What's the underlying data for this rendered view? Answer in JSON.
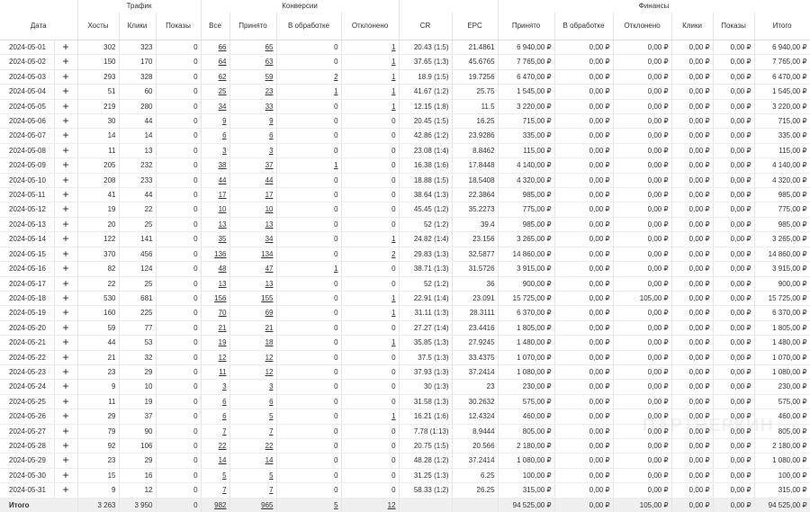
{
  "groups": {
    "traffic": "Трафик",
    "conversions": "Конверсии",
    "finance": "Финансы"
  },
  "columns": [
    "Дата",
    "Хосты",
    "Клики",
    "Показы",
    "Все",
    "Принято",
    "В обработке",
    "Отклонено",
    "CR",
    "EPC",
    "Принято",
    "В обработке",
    "Отклонено",
    "Клики",
    "Показы",
    "Итого"
  ],
  "rows": [
    [
      "2024-05-01",
      "302",
      "323",
      "0",
      "66",
      "65",
      "0",
      "1",
      "20.43 (1:5)",
      "21.4861",
      "6 940,00 ₽",
      "0,00 ₽",
      "0,00 ₽",
      "0,00 ₽",
      "0,00 ₽",
      "6 940,00 ₽"
    ],
    [
      "2024-05-02",
      "150",
      "170",
      "0",
      "64",
      "63",
      "0",
      "1",
      "37.65 (1:3)",
      "45.6765",
      "7 765,00 ₽",
      "0,00 ₽",
      "0,00 ₽",
      "0,00 ₽",
      "0,00 ₽",
      "7 765,00 ₽"
    ],
    [
      "2024-05-03",
      "293",
      "328",
      "0",
      "62",
      "59",
      "2",
      "1",
      "18.9 (1:5)",
      "19.7256",
      "6 470,00 ₽",
      "0,00 ₽",
      "0,00 ₽",
      "0,00 ₽",
      "0,00 ₽",
      "6 470,00 ₽"
    ],
    [
      "2024-05-04",
      "51",
      "60",
      "0",
      "25",
      "23",
      "1",
      "1",
      "41.67 (1:2)",
      "25.75",
      "1 545,00 ₽",
      "0,00 ₽",
      "0,00 ₽",
      "0,00 ₽",
      "0,00 ₽",
      "1 545,00 ₽"
    ],
    [
      "2024-05-05",
      "219",
      "280",
      "0",
      "34",
      "33",
      "0",
      "1",
      "12.15 (1:8)",
      "11.5",
      "3 220,00 ₽",
      "0,00 ₽",
      "0,00 ₽",
      "0,00 ₽",
      "0,00 ₽",
      "3 220,00 ₽"
    ],
    [
      "2024-05-06",
      "30",
      "44",
      "0",
      "9",
      "9",
      "0",
      "0",
      "20.45 (1:5)",
      "16.25",
      "715,00 ₽",
      "0,00 ₽",
      "0,00 ₽",
      "0,00 ₽",
      "0,00 ₽",
      "715,00 ₽"
    ],
    [
      "2024-05-07",
      "14",
      "14",
      "0",
      "6",
      "6",
      "0",
      "0",
      "42.86 (1:2)",
      "23.9286",
      "335,00 ₽",
      "0,00 ₽",
      "0,00 ₽",
      "0,00 ₽",
      "0,00 ₽",
      "335,00 ₽"
    ],
    [
      "2024-05-08",
      "11",
      "13",
      "0",
      "3",
      "3",
      "0",
      "0",
      "23.08 (1:4)",
      "8.8462",
      "115,00 ₽",
      "0,00 ₽",
      "0,00 ₽",
      "0,00 ₽",
      "0,00 ₽",
      "115,00 ₽"
    ],
    [
      "2024-05-09",
      "205",
      "232",
      "0",
      "38",
      "37",
      "1",
      "0",
      "16.38 (1:6)",
      "17.8448",
      "4 140,00 ₽",
      "0,00 ₽",
      "0,00 ₽",
      "0,00 ₽",
      "0,00 ₽",
      "4 140,00 ₽"
    ],
    [
      "2024-05-10",
      "208",
      "233",
      "0",
      "44",
      "44",
      "0",
      "0",
      "18.88 (1:5)",
      "18.5408",
      "4 320,00 ₽",
      "0,00 ₽",
      "0,00 ₽",
      "0,00 ₽",
      "0,00 ₽",
      "4 320,00 ₽"
    ],
    [
      "2024-05-11",
      "41",
      "44",
      "0",
      "17",
      "17",
      "0",
      "0",
      "38.64 (1:3)",
      "22.3864",
      "985,00 ₽",
      "0,00 ₽",
      "0,00 ₽",
      "0,00 ₽",
      "0,00 ₽",
      "985,00 ₽"
    ],
    [
      "2024-05-12",
      "19",
      "22",
      "0",
      "10",
      "10",
      "0",
      "0",
      "45.45 (1:2)",
      "35.2273",
      "775,00 ₽",
      "0,00 ₽",
      "0,00 ₽",
      "0,00 ₽",
      "0,00 ₽",
      "775,00 ₽"
    ],
    [
      "2024-05-13",
      "20",
      "25",
      "0",
      "13",
      "13",
      "0",
      "0",
      "52 (1:2)",
      "39.4",
      "985,00 ₽",
      "0,00 ₽",
      "0,00 ₽",
      "0,00 ₽",
      "0,00 ₽",
      "985,00 ₽"
    ],
    [
      "2024-05-14",
      "122",
      "141",
      "0",
      "35",
      "34",
      "0",
      "1",
      "24.82 (1:4)",
      "23.156",
      "3 265,00 ₽",
      "0,00 ₽",
      "0,00 ₽",
      "0,00 ₽",
      "0,00 ₽",
      "3 265,00 ₽"
    ],
    [
      "2024-05-15",
      "370",
      "456",
      "0",
      "136",
      "134",
      "0",
      "2",
      "29.83 (1:3)",
      "32.5877",
      "14 860,00 ₽",
      "0,00 ₽",
      "0,00 ₽",
      "0,00 ₽",
      "0,00 ₽",
      "14 860,00 ₽"
    ],
    [
      "2024-05-16",
      "82",
      "124",
      "0",
      "48",
      "47",
      "1",
      "0",
      "38.71 (1:3)",
      "31.5726",
      "3 915,00 ₽",
      "0,00 ₽",
      "0,00 ₽",
      "0,00 ₽",
      "0,00 ₽",
      "3 915,00 ₽"
    ],
    [
      "2024-05-17",
      "22",
      "25",
      "0",
      "13",
      "13",
      "0",
      "0",
      "52 (1:2)",
      "36",
      "900,00 ₽",
      "0,00 ₽",
      "0,00 ₽",
      "0,00 ₽",
      "0,00 ₽",
      "900,00 ₽"
    ],
    [
      "2024-05-18",
      "530",
      "681",
      "0",
      "156",
      "155",
      "0",
      "1",
      "22.91 (1:4)",
      "23.091",
      "15 725,00 ₽",
      "0,00 ₽",
      "105,00 ₽",
      "0,00 ₽",
      "0,00 ₽",
      "15 725,00 ₽"
    ],
    [
      "2024-05-19",
      "160",
      "225",
      "0",
      "70",
      "69",
      "0",
      "1",
      "31.11 (1:3)",
      "28.3111",
      "6 370,00 ₽",
      "0,00 ₽",
      "0,00 ₽",
      "0,00 ₽",
      "0,00 ₽",
      "6 370,00 ₽"
    ],
    [
      "2024-05-20",
      "59",
      "77",
      "0",
      "21",
      "21",
      "0",
      "0",
      "27.27 (1:4)",
      "23.4416",
      "1 805,00 ₽",
      "0,00 ₽",
      "0,00 ₽",
      "0,00 ₽",
      "0,00 ₽",
      "1 805,00 ₽"
    ],
    [
      "2024-05-21",
      "44",
      "53",
      "0",
      "19",
      "18",
      "0",
      "1",
      "35.85 (1:3)",
      "27.9245",
      "1 480,00 ₽",
      "0,00 ₽",
      "0,00 ₽",
      "0,00 ₽",
      "0,00 ₽",
      "1 480,00 ₽"
    ],
    [
      "2024-05-22",
      "21",
      "32",
      "0",
      "12",
      "12",
      "0",
      "0",
      "37.5 (1:3)",
      "33.4375",
      "1 070,00 ₽",
      "0,00 ₽",
      "0,00 ₽",
      "0,00 ₽",
      "0,00 ₽",
      "1 070,00 ₽"
    ],
    [
      "2024-05-23",
      "23",
      "29",
      "0",
      "11",
      "12",
      "0",
      "0",
      "37.93 (1:3)",
      "37.2414",
      "1 080,00 ₽",
      "0,00 ₽",
      "0,00 ₽",
      "0,00 ₽",
      "0,00 ₽",
      "1 080,00 ₽"
    ],
    [
      "2024-05-24",
      "9",
      "10",
      "0",
      "3",
      "3",
      "0",
      "0",
      "30 (1:3)",
      "23",
      "230,00 ₽",
      "0,00 ₽",
      "0,00 ₽",
      "0,00 ₽",
      "0,00 ₽",
      "230,00 ₽"
    ],
    [
      "2024-05-25",
      "11",
      "19",
      "0",
      "6",
      "6",
      "0",
      "0",
      "31.58 (1:3)",
      "30.2632",
      "575,00 ₽",
      "0,00 ₽",
      "0,00 ₽",
      "0,00 ₽",
      "0,00 ₽",
      "575,00 ₽"
    ],
    [
      "2024-05-26",
      "29",
      "37",
      "0",
      "6",
      "5",
      "0",
      "1",
      "16.21 (1:6)",
      "12.4324",
      "460,00 ₽",
      "0,00 ₽",
      "0,00 ₽",
      "0,00 ₽",
      "0,00 ₽",
      "460,00 ₽"
    ],
    [
      "2024-05-27",
      "79",
      "90",
      "0",
      "7",
      "7",
      "0",
      "0",
      "7.78 (1:13)",
      "8.9444",
      "805,00 ₽",
      "0,00 ₽",
      "0,00 ₽",
      "0,00 ₽",
      "0,00 ₽",
      "805,00 ₽"
    ],
    [
      "2024-05-28",
      "92",
      "106",
      "0",
      "22",
      "22",
      "0",
      "0",
      "20.75 (1:5)",
      "20.566",
      "2 180,00 ₽",
      "0,00 ₽",
      "0,00 ₽",
      "0,00 ₽",
      "0,00 ₽",
      "2 180,00 ₽"
    ],
    [
      "2024-05-29",
      "23",
      "29",
      "0",
      "14",
      "14",
      "0",
      "0",
      "48.28 (1:2)",
      "37.2414",
      "1 080,00 ₽",
      "0,00 ₽",
      "0,00 ₽",
      "0,00 ₽",
      "0,00 ₽",
      "1 080,00 ₽"
    ],
    [
      "2024-05-30",
      "15",
      "16",
      "0",
      "5",
      "5",
      "0",
      "0",
      "31.25 (1:3)",
      "6.25",
      "100,00 ₽",
      "0,00 ₽",
      "0,00 ₽",
      "0,00 ₽",
      "0,00 ₽",
      "100,00 ₽"
    ],
    [
      "2024-05-31",
      "9",
      "12",
      "0",
      "7",
      "7",
      "0",
      "0",
      "58.33 (1:2)",
      "26.25",
      "315,00 ₽",
      "0,00 ₽",
      "0,00 ₽",
      "0,00 ₽",
      "0,00 ₽",
      "315,00 ₽"
    ]
  ],
  "total": [
    "Итого",
    "3 263",
    "3 950",
    "0",
    "982",
    "965",
    "5",
    "12",
    "",
    "",
    "94 525,00 ₽",
    "0,00 ₽",
    "105,00 ₽",
    "0,00 ₽",
    "0,00 ₽",
    "94 525,00 ₽"
  ],
  "expand_glyph": "+",
  "watermark": "ПАРТНЕРКИН"
}
